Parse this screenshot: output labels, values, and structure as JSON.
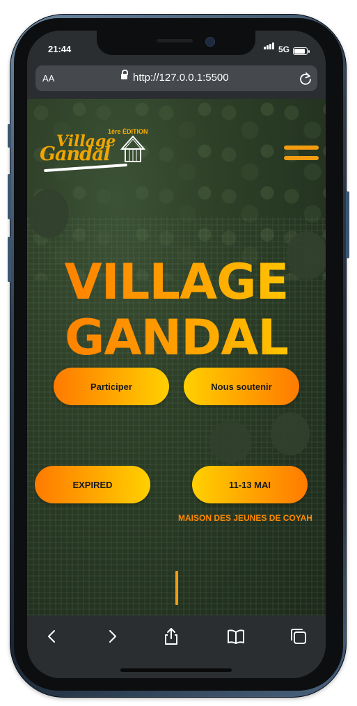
{
  "status_bar": {
    "time": "21:44",
    "network": "5G"
  },
  "browser": {
    "text_size_label": "AA",
    "url": "http://127.0.0.1:5500"
  },
  "logo": {
    "village": "Village",
    "gandal": "Gandal",
    "edition": "1ère ÉDITION"
  },
  "hero": {
    "line1": "VILLAGE",
    "line2": "GANDAL"
  },
  "buttons": {
    "participate": "Participer",
    "support": "Nous soutenir",
    "expired": "EXPIRED",
    "dates": "11-13 MAI"
  },
  "venue": "MAISON DES JEUNES DE COYAH",
  "colors": {
    "accent_orange": "#ff7a00",
    "accent_yellow": "#ffd000",
    "page_bg": "#2a3a26"
  },
  "toolbar": {
    "icons": [
      "back-icon",
      "forward-icon",
      "share-icon",
      "bookmarks-icon",
      "tabs-icon"
    ]
  }
}
